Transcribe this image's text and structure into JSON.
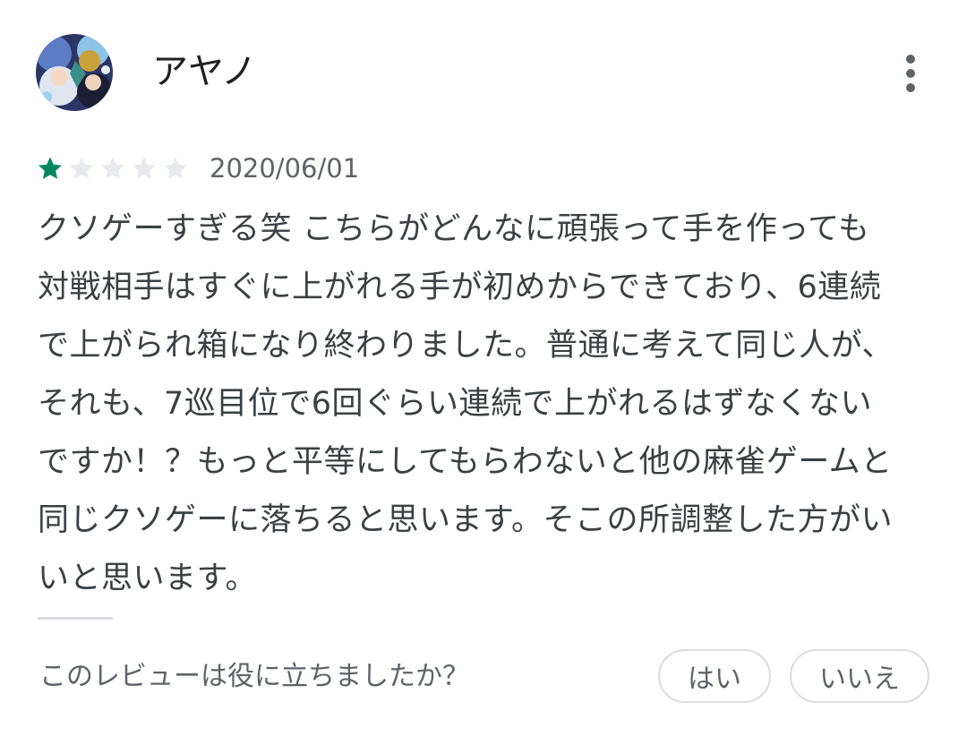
{
  "review": {
    "author": {
      "name": "アヤノ",
      "avatar_icon": "user-avatar"
    },
    "more_icon": "more-vert-icon",
    "rating": {
      "value": 1,
      "max": 5,
      "filled_color": "#01875f",
      "empty_color": "#e8eaed"
    },
    "date": "2020/06/01",
    "text_lines": [
      "クソゲーすぎる笑 こちらがどんなに頑張って手を作っても",
      "対戦相手はすぐに上がれる手が初めからできており、6連続",
      "で上がられ箱になり終わりました。普通に考えて同じ人が、",
      "それも、7巡目位で6回ぐらい連続で上がれるはずなくない",
      "ですか！？もっと平等にしてもらわないと他の麻雀ゲームと",
      "同じクソゲーに落ちると思います。そこの所調整した方がい",
      "いと思います。"
    ],
    "helpful": {
      "question": "このレビューは役に立ちましたか？",
      "yes_label": "はい",
      "no_label": "いいえ"
    }
  }
}
